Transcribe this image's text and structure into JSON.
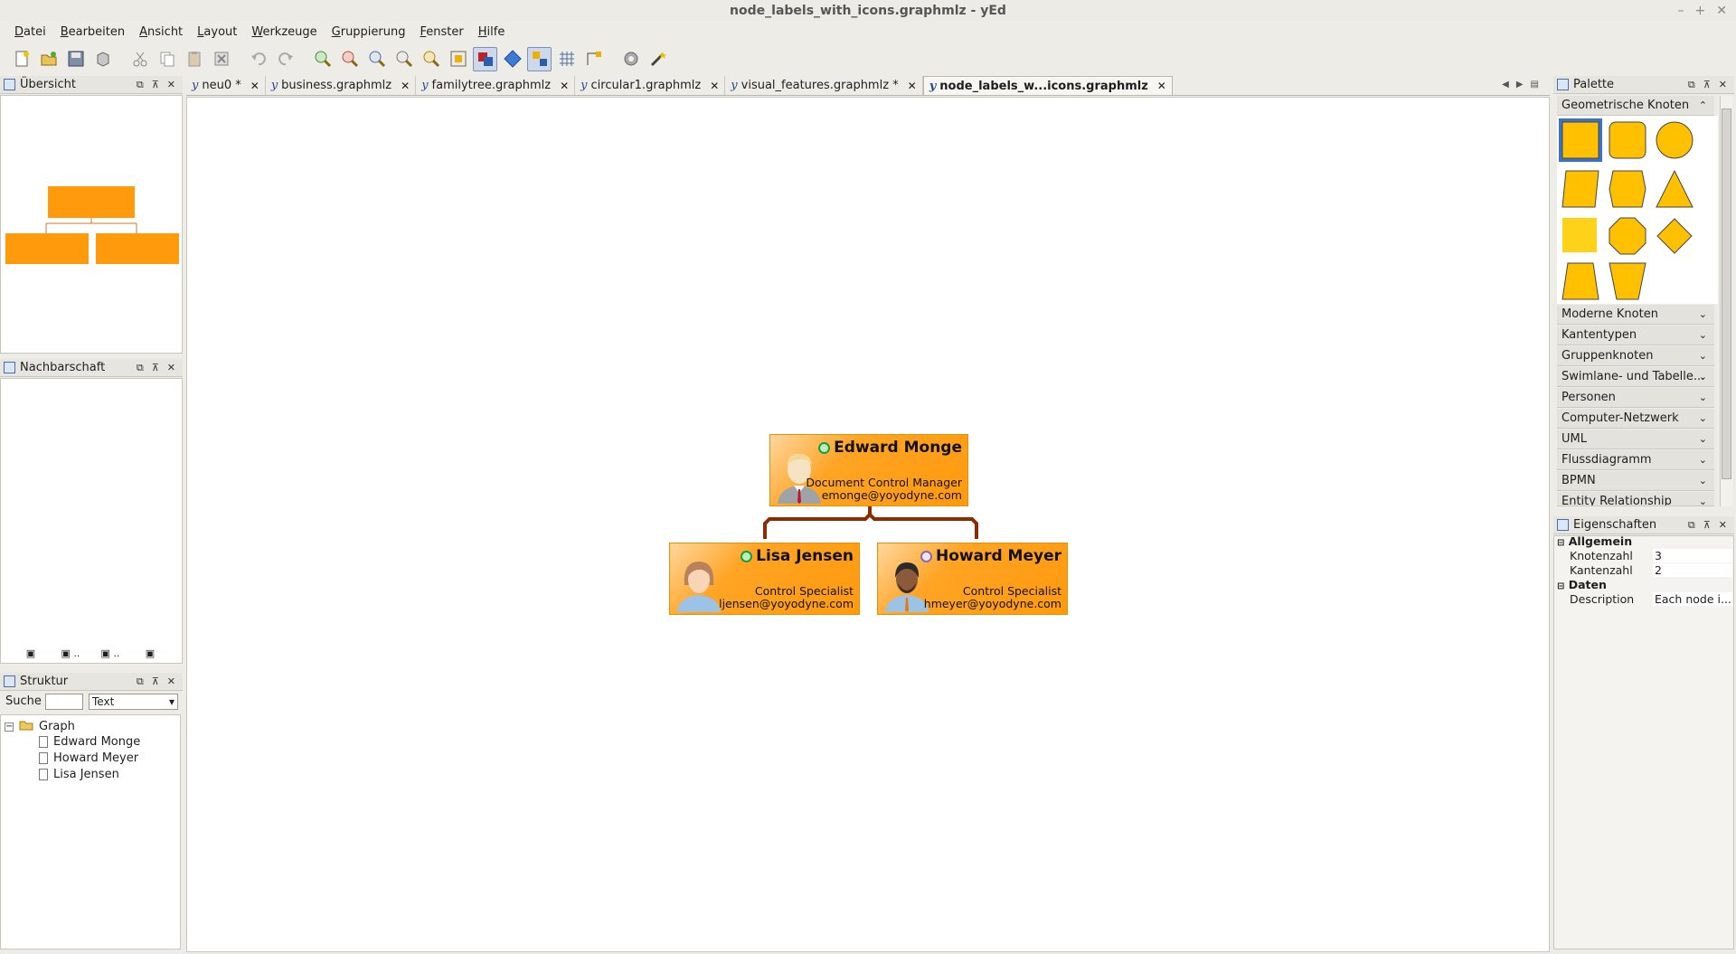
{
  "window": {
    "title": "node_labels_with_icons.graphmlz - yEd",
    "controls": [
      "–",
      "+",
      "✕"
    ]
  },
  "menu": [
    "Datei",
    "Bearbeiten",
    "Ansicht",
    "Layout",
    "Werkzeuge",
    "Gruppierung",
    "Fenster",
    "Hilfe"
  ],
  "toolbar": {
    "buttons": [
      "new-file-icon",
      "open-file-icon",
      "save-icon",
      "export-icon",
      "cut-icon",
      "copy-icon",
      "paste-icon",
      "delete-icon",
      "undo-icon",
      "redo-icon",
      "zoom-in-icon",
      "zoom-out-icon",
      "zoom-fit-icon",
      "zoom-original-icon",
      "zoom-selection-icon",
      "fit-content-icon",
      "edit-mode-icon",
      "navigation-mode-icon",
      "snapping-icon",
      "grid-icon",
      "orthogonal-edges-icon",
      "settings-icon",
      "wizard-icon"
    ]
  },
  "overview": {
    "title": "Übersicht"
  },
  "neighborhood": {
    "title": "Nachbarschaft",
    "tabs": [
      "",
      "..",
      "..",
      ""
    ]
  },
  "structure": {
    "title": "Struktur",
    "search_label": "Suche",
    "search_value": "",
    "search_mode": "Text",
    "root": "Graph",
    "items": [
      "Edward Monge",
      "Howard Meyer",
      "Lisa Jensen"
    ]
  },
  "tabs": [
    {
      "label": "neu0 *",
      "active": false
    },
    {
      "label": "business.graphmlz",
      "active": false
    },
    {
      "label": "familytree.graphmlz",
      "active": false
    },
    {
      "label": "circular1.graphmlz",
      "active": false
    },
    {
      "label": "visual_features.graphmlz *",
      "active": false
    },
    {
      "label": "node_labels_w...icons.graphmlz",
      "active": true
    }
  ],
  "graph": {
    "nodes": [
      {
        "name": "Edward Monge",
        "role": "Document Control Manager",
        "email": "emonge@yoyodyne.com",
        "status": "online",
        "avatar": "blonde-manager-avatar"
      },
      {
        "name": "Lisa Jensen",
        "role": "Control Specialist",
        "email": "ljensen@yoyodyne.com",
        "status": "online",
        "avatar": "female-avatar"
      },
      {
        "name": "Howard Meyer",
        "role": "Control Specialist",
        "email": "hmeyer@yoyodyne.com",
        "status": "away",
        "avatar": "male-avatar"
      }
    ],
    "colors": {
      "node_fill": "#ff9a0c",
      "edge": "#8b2c00"
    }
  },
  "palette": {
    "title": "Palette",
    "open_section": "Geometrische Knoten",
    "shapes": [
      "rectangle",
      "rounded-rectangle",
      "ellipse",
      "parallelogram",
      "hexagon",
      "triangle",
      "plain-rectangle",
      "octagon",
      "diamond",
      "trapezoid",
      "inverted-trapezoid"
    ],
    "sections": [
      "Moderne Knoten",
      "Kantentypen",
      "Gruppenknoten",
      "Swimlane- und Tabelle...",
      "Personen",
      "Computer-Netzwerk",
      "UML",
      "Flussdiagramm",
      "BPMN",
      "Entity Relationship"
    ]
  },
  "properties": {
    "title": "Eigenschaften",
    "groups": [
      {
        "name": "Allgemein",
        "rows": [
          {
            "key": "Knotenzahl",
            "value": "3"
          },
          {
            "key": "Kantenzahl",
            "value": "2"
          }
        ]
      },
      {
        "name": "Daten",
        "rows": [
          {
            "key": "Description",
            "value": "Each node i..."
          }
        ]
      }
    ]
  }
}
